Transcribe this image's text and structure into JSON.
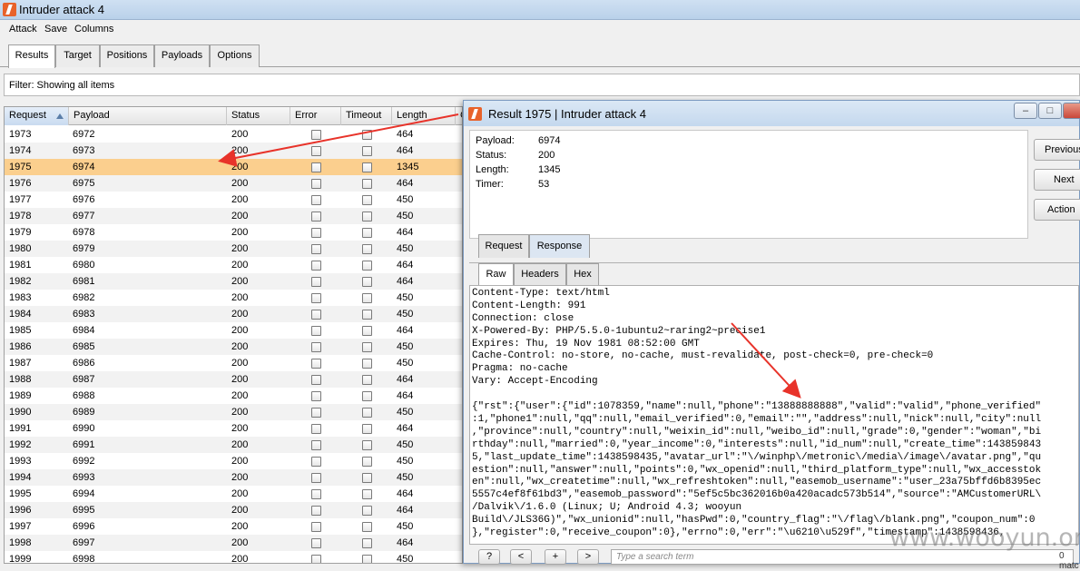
{
  "window": {
    "title": "Intruder attack 4"
  },
  "menu": [
    "Attack",
    "Save",
    "Columns"
  ],
  "tabs": [
    "Results",
    "Target",
    "Positions",
    "Payloads",
    "Options"
  ],
  "filter": {
    "text": "Filter:  Showing all items"
  },
  "table": {
    "columns": [
      "Request",
      "Payload",
      "Status",
      "Error",
      "Timeout",
      "Length",
      "C"
    ],
    "rows": [
      {
        "request": "1973",
        "payload": "6972",
        "status": "200",
        "length": "464"
      },
      {
        "request": "1974",
        "payload": "6973",
        "status": "200",
        "length": "464"
      },
      {
        "request": "1975",
        "payload": "6974",
        "status": "200",
        "length": "1345"
      },
      {
        "request": "1976",
        "payload": "6975",
        "status": "200",
        "length": "464"
      },
      {
        "request": "1977",
        "payload": "6976",
        "status": "200",
        "length": "450"
      },
      {
        "request": "1978",
        "payload": "6977",
        "status": "200",
        "length": "450"
      },
      {
        "request": "1979",
        "payload": "6978",
        "status": "200",
        "length": "464"
      },
      {
        "request": "1980",
        "payload": "6979",
        "status": "200",
        "length": "450"
      },
      {
        "request": "1981",
        "payload": "6980",
        "status": "200",
        "length": "464"
      },
      {
        "request": "1982",
        "payload": "6981",
        "status": "200",
        "length": "464"
      },
      {
        "request": "1983",
        "payload": "6982",
        "status": "200",
        "length": "450"
      },
      {
        "request": "1984",
        "payload": "6983",
        "status": "200",
        "length": "450"
      },
      {
        "request": "1985",
        "payload": "6984",
        "status": "200",
        "length": "464"
      },
      {
        "request": "1986",
        "payload": "6985",
        "status": "200",
        "length": "450"
      },
      {
        "request": "1987",
        "payload": "6986",
        "status": "200",
        "length": "450"
      },
      {
        "request": "1988",
        "payload": "6987",
        "status": "200",
        "length": "464"
      },
      {
        "request": "1989",
        "payload": "6988",
        "status": "200",
        "length": "464"
      },
      {
        "request": "1990",
        "payload": "6989",
        "status": "200",
        "length": "450"
      },
      {
        "request": "1991",
        "payload": "6990",
        "status": "200",
        "length": "464"
      },
      {
        "request": "1992",
        "payload": "6991",
        "status": "200",
        "length": "450"
      },
      {
        "request": "1993",
        "payload": "6992",
        "status": "200",
        "length": "450"
      },
      {
        "request": "1994",
        "payload": "6993",
        "status": "200",
        "length": "450"
      },
      {
        "request": "1995",
        "payload": "6994",
        "status": "200",
        "length": "464"
      },
      {
        "request": "1996",
        "payload": "6995",
        "status": "200",
        "length": "464"
      },
      {
        "request": "1997",
        "payload": "6996",
        "status": "200",
        "length": "450"
      },
      {
        "request": "1998",
        "payload": "6997",
        "status": "200",
        "length": "464"
      },
      {
        "request": "1999",
        "payload": "6998",
        "status": "200",
        "length": "450"
      }
    ]
  },
  "result_window": {
    "title": "Result 1975 | Intruder attack 4",
    "info": [
      {
        "label": "Payload:",
        "value": "6974"
      },
      {
        "label": "Status:",
        "value": "200"
      },
      {
        "label": "Length:",
        "value": "1345"
      },
      {
        "label": "Timer:",
        "value": "53"
      }
    ],
    "buttons": [
      "Previous",
      "Next",
      "Action"
    ],
    "tabs": [
      "Request",
      "Response"
    ],
    "view_tabs": [
      "Raw",
      "Headers",
      "Hex"
    ],
    "headers": [
      "Content-Type: text/html",
      "Content-Length: 991",
      "Connection: close",
      "X-Powered-By: PHP/5.5.0-1ubuntu2~raring2~precise1",
      "Expires: Thu, 19 Nov 1981 08:52:00 GMT",
      "Cache-Control: no-store, no-cache, must-revalidate, post-check=0, pre-check=0",
      "Pragma: no-cache",
      "Vary: Accept-Encoding"
    ],
    "body": [
      "{\"rst\":{\"user\":{\"id\":1078359,\"name\":null,\"phone\":\"13888888888\",\"valid\":\"valid\",\"phone_verified\"",
      ":1,\"phone1\":null,\"qq\":null,\"email_verified\":0,\"email\":\"\",\"address\":null,\"nick\":null,\"city\":null",
      ",\"province\":null,\"country\":null,\"weixin_id\":null,\"weibo_id\":null,\"grade\":0,\"gender\":\"woman\",\"bi",
      "rthday\":null,\"married\":0,\"year_income\":0,\"interests\":null,\"id_num\":null,\"create_time\":143859843",
      "5,\"last_update_time\":1438598435,\"avatar_url\":\"\\/winphp\\/metronic\\/media\\/image\\/avatar.png\",\"qu",
      "estion\":null,\"answer\":null,\"points\":0,\"wx_openid\":null,\"third_platform_type\":null,\"wx_accesstok",
      "en\":null,\"wx_createtime\":null,\"wx_refreshtoken\":null,\"easemob_username\":\"user_23a75bffd6b8395ec",
      "5557c4ef8f61bd3\",\"easemob_password\":\"5ef5c5bc362016b0a420acadc573b514\",\"source\":\"AMCustomerURL\\",
      "/Dalvik\\/1.6.0 (Linux; U; Android 4.3; wooyun",
      "Build\\/JLS36G)\",\"wx_unionid\":null,\"hasPwd\":0,\"country_flag\":\"\\/flag\\/blank.png\",\"coupon_num\":0",
      "},\"register\":0,\"receive_coupon\":0},\"errno\":0,\"err\":\"\\u6210\\u529f\",\"timestamp\":1438598436,"
    ],
    "nav_buttons": [
      "?",
      "<",
      "+",
      ">"
    ],
    "search_placeholder": "Type a search term",
    "matches": "0 matc"
  },
  "watermark": "www.wooyun.org",
  "colors": {
    "selected_row": "#fbcf8e",
    "arrow": "#e8332a"
  }
}
